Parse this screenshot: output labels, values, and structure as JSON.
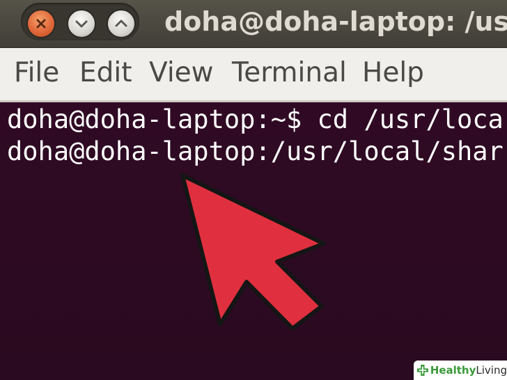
{
  "window": {
    "title": "doha@doha-laptop: /us",
    "buttons": [
      {
        "name": "close",
        "icon": "close-icon",
        "color": "#e0683a"
      },
      {
        "name": "minimize",
        "icon": "chevron-down-icon",
        "color": "#d8d6d0"
      },
      {
        "name": "maximize",
        "icon": "chevron-up-icon",
        "color": "#d8d6d0"
      }
    ]
  },
  "menubar": {
    "items": [
      "File",
      "Edit",
      "View",
      "Terminal",
      "Help"
    ]
  },
  "terminal": {
    "background": "#300a24",
    "lines": [
      "doha@doha-laptop:~$ cd /usr/loca",
      "doha@doha-laptop:/usr/local/shar"
    ]
  },
  "overlay": {
    "pointer_icon": "arrow-pointer-icon",
    "pointer_color": "#e0303f"
  },
  "watermark": {
    "prefix": "Healthy",
    "suffix": "Living",
    "icon": "cross-logo-icon"
  }
}
